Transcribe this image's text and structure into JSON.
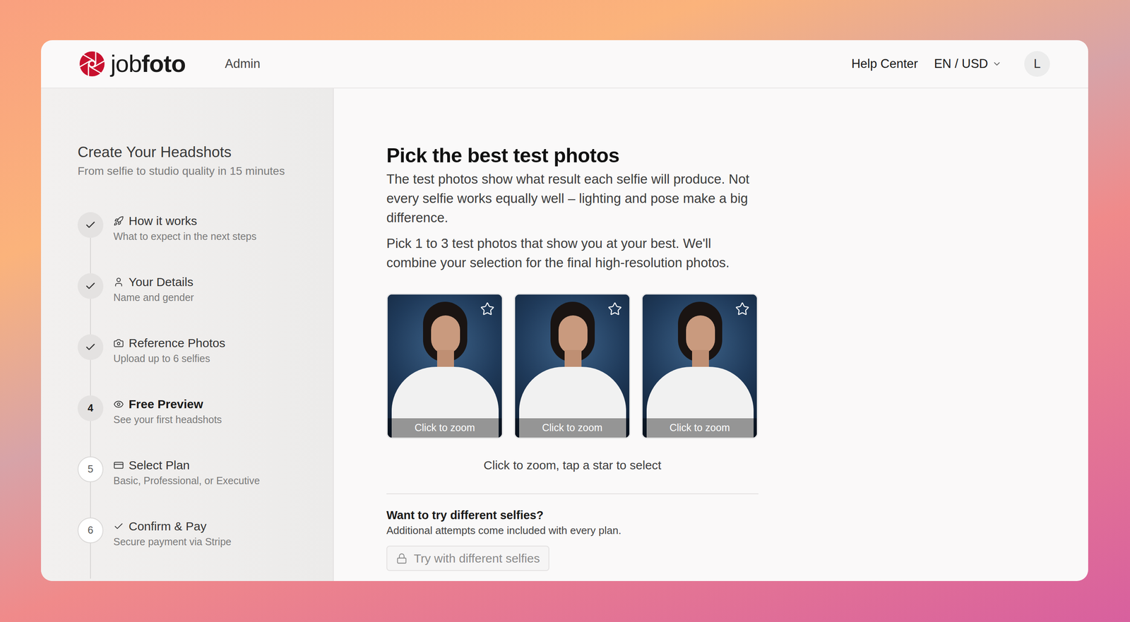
{
  "app": {
    "logo": {
      "prefix": "job",
      "suffix": "foto"
    },
    "section": "Admin"
  },
  "header": {
    "help": "Help Center",
    "locale": "EN / USD",
    "avatar": "L"
  },
  "sidebar": {
    "title": "Create Your Headshots",
    "subtitle": "From selfie to studio quality in 15 minutes",
    "steps": [
      {
        "title": "How it works",
        "subtitle": "What to expect in the next steps",
        "status": "done"
      },
      {
        "title": "Your Details",
        "subtitle": "Name and gender",
        "status": "done"
      },
      {
        "title": "Reference Photos",
        "subtitle": "Upload up to 6 selfies",
        "status": "done"
      },
      {
        "number": "4",
        "title": "Free Preview",
        "subtitle": "See your first headshots",
        "status": "current"
      },
      {
        "number": "5",
        "title": "Select Plan",
        "subtitle": "Basic, Professional, or Executive",
        "status": "upcoming"
      },
      {
        "number": "6",
        "title": "Confirm & Pay",
        "subtitle": "Secure payment via Stripe",
        "status": "upcoming"
      }
    ]
  },
  "main": {
    "title": "Pick the best test photos",
    "paragraphs": [
      "The test photos show what result each selfie will produce. Not every selfie works equally well – lighting and pose make a big difference.",
      "Pick 1 to 3 test photos that show you at your best. We'll combine your selection for the final high-resolution photos."
    ],
    "photos": [
      {
        "label": "Click to zoom",
        "selected": false
      },
      {
        "label": "Click to zoom",
        "selected": false
      },
      {
        "label": "Click to zoom",
        "selected": false
      }
    ],
    "hint": "Click to zoom, tap a star to select",
    "retry": {
      "title": "Want to try different selfies?",
      "text": "Additional attempts come included with every plan.",
      "button": {
        "label": "Try with different selfies",
        "disabled": true
      }
    }
  }
}
